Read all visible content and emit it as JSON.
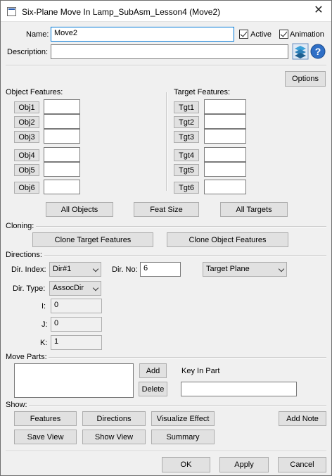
{
  "window": {
    "title": "Six-Plane Move In Lamp_SubAsm_Lesson4 (Move2)",
    "close_glyph": "✕"
  },
  "name": {
    "label": "Name:",
    "value": "Move2"
  },
  "active": {
    "label": "Active"
  },
  "animation": {
    "label": "Animation"
  },
  "description": {
    "label": "Description:",
    "value": ""
  },
  "options_label": "Options",
  "object_features": {
    "label": "Object Features:",
    "items": [
      {
        "label": "Obj1",
        "value": ""
      },
      {
        "label": "Obj2",
        "value": ""
      },
      {
        "label": "Obj3",
        "value": ""
      },
      {
        "label": "Obj4",
        "value": ""
      },
      {
        "label": "Obj5",
        "value": ""
      },
      {
        "label": "Obj6",
        "value": ""
      }
    ]
  },
  "target_features": {
    "label": "Target Features:",
    "items": [
      {
        "label": "Tgt1",
        "value": ""
      },
      {
        "label": "Tgt2",
        "value": ""
      },
      {
        "label": "Tgt3",
        "value": ""
      },
      {
        "label": "Tgt4",
        "value": ""
      },
      {
        "label": "Tgt5",
        "value": ""
      },
      {
        "label": "Tgt6",
        "value": ""
      }
    ]
  },
  "feature_buttons": {
    "all_objects": "All Objects",
    "feat_size": "Feat Size",
    "all_targets": "All Targets"
  },
  "cloning": {
    "label": "Cloning:",
    "clone_target": "Clone Target Features",
    "clone_object": "Clone Object Features"
  },
  "directions": {
    "label": "Directions:",
    "dir_index_label": "Dir. Index:",
    "dir_index_value": "Dir#1",
    "dir_no_label": "Dir. No:",
    "dir_no_value": "6",
    "plane_value": "Target Plane",
    "dir_type_label": "Dir. Type:",
    "dir_type_value": "AssocDir",
    "i_label": "I:",
    "i_value": "0",
    "j_label": "J:",
    "j_value": "0",
    "k_label": "K:",
    "k_value": "1"
  },
  "move_parts": {
    "label": "Move Parts:",
    "add": "Add",
    "delete": "Delete",
    "key_in_label": "Key In Part",
    "key_in_value": ""
  },
  "show": {
    "label": "Show:",
    "features": "Features",
    "directions": "Directions",
    "visualize_effect": "Visualize Effect",
    "add_note": "Add Note",
    "save_view": "Save View",
    "show_view": "Show View",
    "summary": "Summary"
  },
  "footer": {
    "ok": "OK",
    "apply": "Apply",
    "cancel": "Cancel"
  }
}
